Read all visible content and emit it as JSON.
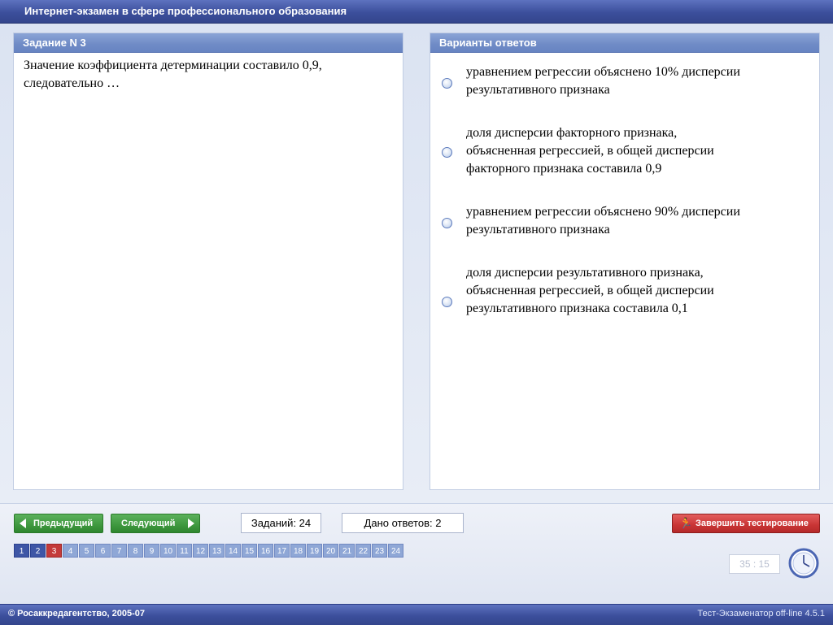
{
  "window": {
    "title": "Интернет-экзамен в сфере профессионального образования"
  },
  "task": {
    "header": "Задание N 3",
    "question": "Значение коэффициента детерминации составило 0,9,\nследовательно …"
  },
  "answers": {
    "header": "Варианты ответов",
    "options": [
      "уравнением регрессии объяснено 10% дисперсии\nрезультативного признака",
      "доля дисперсии факторного признака,\nобъясненная  регрессией, в общей дисперсии\nфакторного признака составила 0,9",
      "уравнением регрессии объяснено 90% дисперсии\nрезультативного признака",
      "доля дисперсии результативного признака,\nобъясненная  регрессией, в общей дисперсии\nрезультативного признака составила 0,1"
    ]
  },
  "navigation": {
    "prev_label": "Предыдущий",
    "next_label": "Следующий",
    "tasks_count": "Заданий: 24",
    "answers_given": "Дано ответов: 2",
    "finish_label": "Завершить тестирование",
    "pages": [
      "1",
      "2",
      "3",
      "4",
      "5",
      "6",
      "7",
      "8",
      "9",
      "10",
      "11",
      "12",
      "13",
      "14",
      "15",
      "16",
      "17",
      "18",
      "19",
      "20",
      "21",
      "22",
      "23",
      "24"
    ],
    "answered_pages": [
      "1",
      "2"
    ],
    "current_page": "3"
  },
  "timer": {
    "value": "35 : 15"
  },
  "status": {
    "copyright": "© Росаккредагентство, 2005-07",
    "version": "Тест-Экзаменатор off-line 4.5.1"
  },
  "colors": {
    "title_bar": "#3c4f9c",
    "panel_header": "#6f8bc6",
    "nav_button": "#3f983f",
    "finish_button": "#c93535",
    "page_current": "#c43a3a",
    "page_answered": "#3e56a6",
    "page_default": "#8fa7d6"
  }
}
